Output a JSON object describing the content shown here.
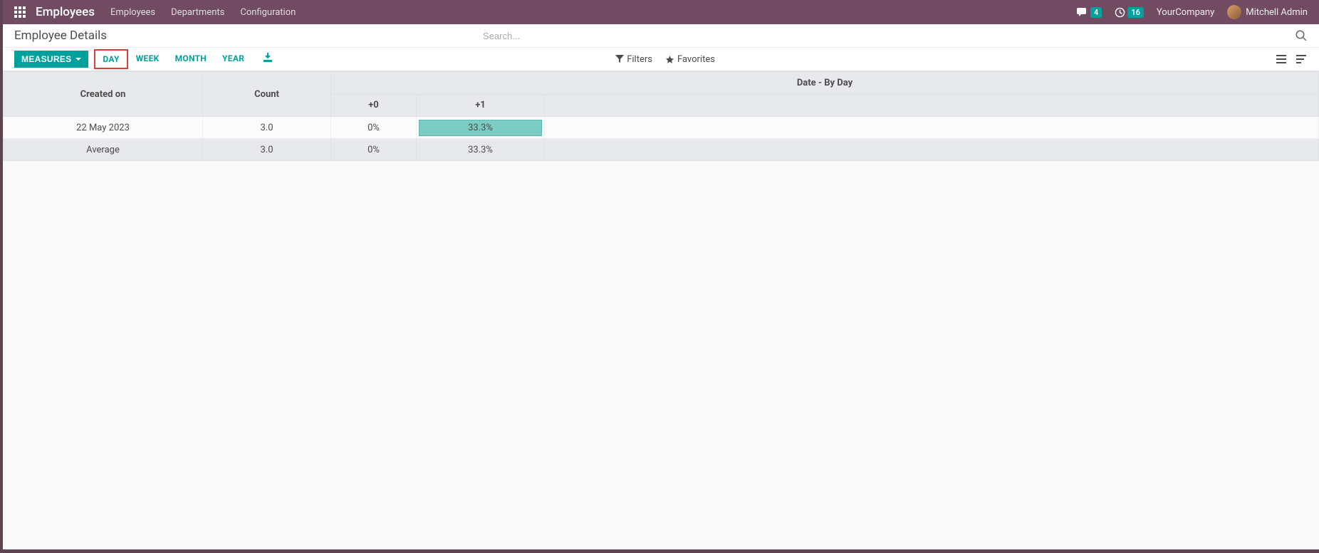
{
  "topbar": {
    "brand": "Employees",
    "nav": [
      "Employees",
      "Departments",
      "Configuration"
    ],
    "messages_badge": "4",
    "activities_badge": "16",
    "company": "YourCompany",
    "user": "Mitchell Admin"
  },
  "header": {
    "title": "Employee Details",
    "search_placeholder": "Search..."
  },
  "toolbar": {
    "measures_label": "MEASURES",
    "periods": [
      "DAY",
      "WEEK",
      "MONTH",
      "YEAR"
    ],
    "active_period": "DAY",
    "filters_label": "Filters",
    "favorites_label": "Favorites"
  },
  "table": {
    "col_created": "Created on",
    "col_count": "Count",
    "col_group": "Date - By Day",
    "day_cols": [
      "+0",
      "+1"
    ],
    "rows": [
      {
        "label": "22 May 2023",
        "count": "3.0",
        "d0": "0%",
        "d1": "33.3%",
        "highlight": true
      }
    ],
    "average": {
      "label": "Average",
      "count": "3.0",
      "d0": "0%",
      "d1": "33.3%"
    }
  }
}
